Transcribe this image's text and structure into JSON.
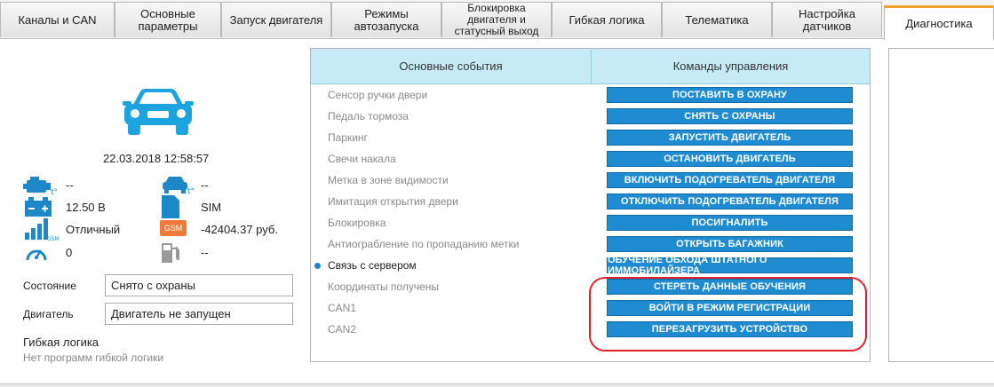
{
  "tabs": [
    {
      "label": "Каналы и CAN"
    },
    {
      "label": "Основные параметры"
    },
    {
      "label": "Запуск двигателя"
    },
    {
      "label": "Режимы автозапуска"
    },
    {
      "label": "Блокировка двигателя и статусный выход"
    },
    {
      "label": "Гибкая логика"
    },
    {
      "label": "Телематика"
    },
    {
      "label": "Настройка датчиков"
    },
    {
      "label": "Диагностика",
      "active": true
    }
  ],
  "status": {
    "datetime": "22.03.2018  12:58:57",
    "engine_temp": "--",
    "cabin_temp": "--",
    "battery": "12.50 В",
    "sim": "SIM",
    "gsm_signal": "Отличный",
    "gsm_label": "GSM",
    "balance": "-42404.37 руб.",
    "speed": "0",
    "fuel": "--"
  },
  "fields": {
    "state_label": "Состояние",
    "state_value": "Снято с охраны",
    "engine_label": "Двигатель",
    "engine_value": "Двигатель не запущен"
  },
  "logic": {
    "title": "Гибкая логика",
    "subtitle": "Нет программ гибкой логики"
  },
  "events_header": "Основные события",
  "commands_header": "Команды управления",
  "events": [
    {
      "label": "Сенсор ручки двери"
    },
    {
      "label": "Педаль тормоза"
    },
    {
      "label": "Паркинг"
    },
    {
      "label": "Свечи накала"
    },
    {
      "label": "Метка в зоне видимости"
    },
    {
      "label": "Имитация открытия двери"
    },
    {
      "label": "Блокировка"
    },
    {
      "label": "Антиограбление по пропаданию метки"
    },
    {
      "label": "Связь с сервером",
      "active": true
    },
    {
      "label": "Координаты получены"
    },
    {
      "label": "CAN1"
    },
    {
      "label": "CAN2"
    }
  ],
  "commands": [
    {
      "label": "ПОСТАВИТЬ В ОХРАНУ"
    },
    {
      "label": "СНЯТЬ С ОХРАНЫ"
    },
    {
      "label": "ЗАПУСТИТЬ ДВИГАТЕЛЬ"
    },
    {
      "label": "ОСТАНОВИТЬ ДВИГАТЕЛЬ"
    },
    {
      "label": "ВКЛЮЧИТЬ ПОДОГРЕВАТЕЛЬ ДВИГАТЕЛЯ"
    },
    {
      "label": "ОТКЛЮЧИТЬ ПОДОГРЕВАТЕЛЬ ДВИГАТЕЛЯ"
    },
    {
      "label": "ПОСИГНАЛИТЬ"
    },
    {
      "label": "ОТКРЫТЬ БАГАЖНИК"
    },
    {
      "label": "ОБУЧЕНИЕ ОБХОДА ШТАТНОГО ИММОБИЛАЙЗЕРА"
    },
    {
      "label": "СТЕРЕТЬ ДАННЫЕ ОБУЧЕНИЯ"
    },
    {
      "label": "ВОЙТИ В РЕЖИМ РЕГИСТРАЦИИ"
    },
    {
      "label": "ПЕРЕЗАГРУЗИТЬ УСТРОЙСТВО"
    }
  ],
  "icons": {
    "car": "car-icon",
    "engine_temp": "engine-temperature-icon",
    "cabin_temp": "cabin-temperature-icon",
    "battery": "battery-icon",
    "sim": "sim-card-icon",
    "signal": "gsm-signal-icon",
    "gsm": "gsm-balance-icon",
    "speed": "speedometer-icon",
    "fuel": "fuel-icon"
  },
  "colors": {
    "accent_blue": "#1f8bd1",
    "header_bg": "#c6ebf7",
    "active_tab": "#f0a22a",
    "highlight_red": "#e0202a"
  }
}
